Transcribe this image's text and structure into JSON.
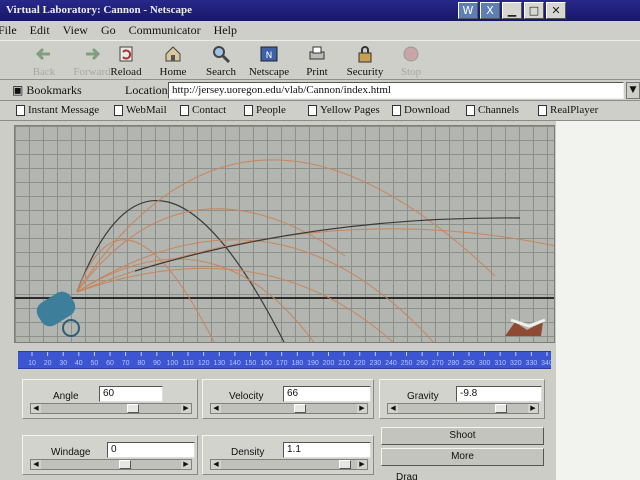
{
  "window": {
    "title": "Virtual Laboratory: Cannon - Netscape"
  },
  "window_buttons": [
    {
      "name": "word-app-icon",
      "glyph": "W",
      "app": true
    },
    {
      "name": "excel-app-icon",
      "glyph": "X",
      "app": true
    },
    {
      "name": "minimize-icon",
      "glyph": "▁",
      "app": false
    },
    {
      "name": "maximize-icon",
      "glyph": "□",
      "app": false
    },
    {
      "name": "close-icon",
      "glyph": "✕",
      "app": false
    }
  ],
  "menu": [
    "File",
    "Edit",
    "View",
    "Go",
    "Communicator",
    "Help"
  ],
  "toolbar": [
    {
      "label": "Back",
      "icon": "back-arrow-icon",
      "disabled": true
    },
    {
      "label": "Forward",
      "icon": "forward-arrow-icon",
      "disabled": true
    },
    {
      "label": "Reload",
      "icon": "reload-icon",
      "disabled": false
    },
    {
      "label": "Home",
      "icon": "home-icon",
      "disabled": false
    },
    {
      "label": "Search",
      "icon": "search-icon",
      "disabled": false
    },
    {
      "label": "Netscape",
      "icon": "netscape-icon",
      "disabled": false
    },
    {
      "label": "Print",
      "icon": "print-icon",
      "disabled": false
    },
    {
      "label": "Security",
      "icon": "security-lock-icon",
      "disabled": false
    },
    {
      "label": "Stop",
      "icon": "stop-icon",
      "disabled": true
    }
  ],
  "location": {
    "bookmarks_label": "Bookmarks",
    "label": "Location:",
    "url": "http://jersey.uoregon.edu/vlab/Cannon/index.html"
  },
  "personal_toolbar": [
    "Instant Message",
    "WebMail",
    "Contact",
    "People",
    "Yellow Pages",
    "Download",
    "Channels",
    "RealPlayer"
  ],
  "ruler": {
    "ticks": [
      "10",
      "20",
      "30",
      "40",
      "50",
      "60",
      "70",
      "80",
      "90",
      "100",
      "110",
      "120",
      "130",
      "140",
      "150",
      "160",
      "170",
      "180",
      "190",
      "200",
      "210",
      "220",
      "230",
      "240",
      "250",
      "260",
      "270",
      "280",
      "290",
      "300",
      "310",
      "320",
      "330",
      "340"
    ]
  },
  "controls": {
    "angle": {
      "label": "Angle",
      "value": "60",
      "slider_fraction": 0.68
    },
    "velocity": {
      "label": "Velocity",
      "value": "66",
      "slider_fraction": 0.6
    },
    "gravity": {
      "label": "Gravity",
      "value": "-9.8",
      "slider_fraction": 0.84
    },
    "windage": {
      "label": "Windage",
      "value": "0",
      "slider_fraction": 0.62
    },
    "density": {
      "label": "Density",
      "value": "1.1",
      "slider_fraction": 0.97
    },
    "shoot_label": "Shoot",
    "more_label": "More",
    "drag_label": "Drag"
  },
  "colors": {
    "titlebar": "#1c1c78",
    "ruler": "#3d55d0",
    "trajectory_orange": "#c8855a",
    "trajectory_dark": "#3a3a3a"
  }
}
